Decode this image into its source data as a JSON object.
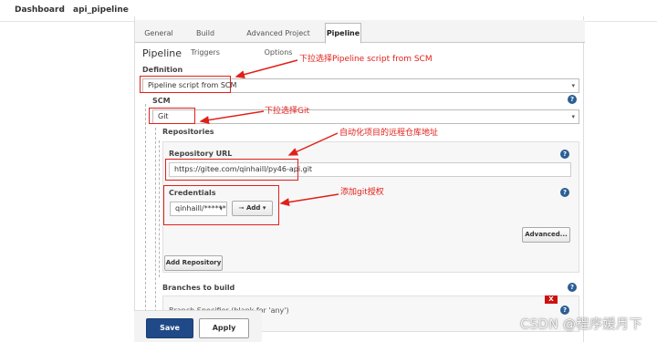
{
  "breadcrumb": {
    "dashboard": "Dashboard",
    "project": "api_pipeline",
    "sep": "›"
  },
  "tabs": [
    "General",
    "Build Triggers",
    "Advanced Project Options",
    "Pipeline"
  ],
  "pipeline": {
    "section_title": "Pipeline",
    "definition_label": "Definition",
    "definition_value": "Pipeline script from SCM",
    "scm_label": "SCM",
    "scm_value": "Git",
    "repositories_label": "Repositories",
    "repo_url_label": "Repository URL",
    "repo_url_value": "https://gitee.com/qinhaill/py46-api.git",
    "credentials_label": "Credentials",
    "credentials_value": "qinhaill/******",
    "add_label": "Add",
    "advanced_label": "Advanced...",
    "add_repository_label": "Add Repository",
    "branches_label": "Branches to build",
    "branch_specifier_label": "Branch Specifier (blank for 'any')",
    "x_label": "X",
    "help": "?"
  },
  "annotations": {
    "definition": "下拉选择Pipeline script from SCM",
    "scm": "下拉选择Git",
    "repo_url": "自动化项目的远程仓库地址",
    "credentials": "添加git授权"
  },
  "footer": {
    "save_label": "Save",
    "apply_label": "Apply"
  },
  "watermark": "CSDN @程序媛月下",
  "colors": {
    "annotation": "#e0201a",
    "save_button": "#204a87",
    "help_icon": "#2b5e94",
    "delete_button": "#cc1111"
  }
}
